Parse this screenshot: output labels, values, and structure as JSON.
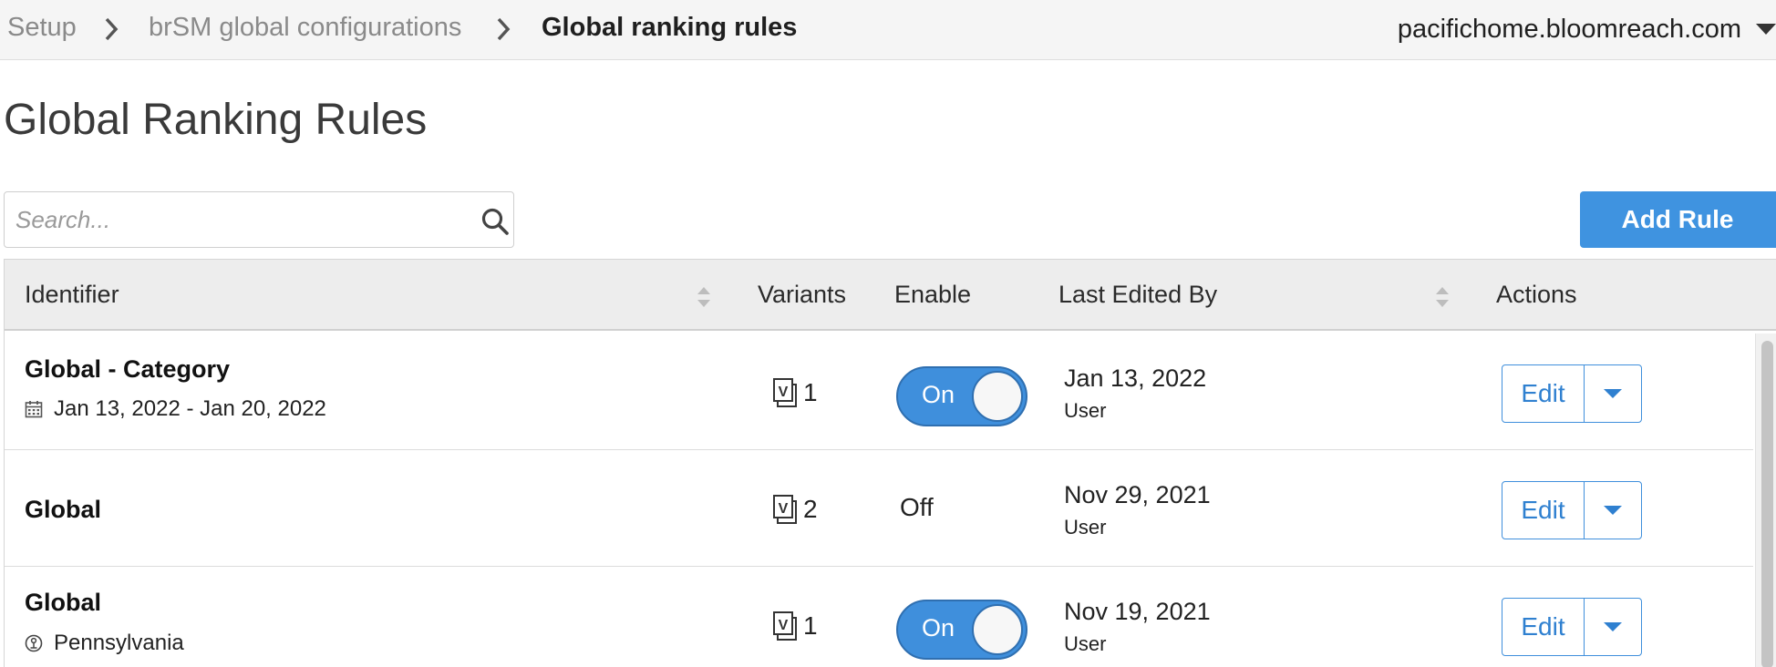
{
  "breadcrumb": {
    "items": [
      "Setup",
      "brSM global configurations",
      "Global ranking rules"
    ]
  },
  "domain_selector": {
    "value": "pacifichome.bloomreach.com"
  },
  "page_title": "Global Ranking Rules",
  "search": {
    "placeholder": "Search...",
    "value": ""
  },
  "add_rule_label": "Add Rule",
  "table": {
    "headers": {
      "identifier": "Identifier",
      "variants": "Variants",
      "enable": "Enable",
      "last_edited_by": "Last Edited By",
      "actions": "Actions"
    },
    "rows": [
      {
        "name": "Global - Category",
        "sub": "Jan 13, 2022 - Jan 20, 2022",
        "sub_icon": "calendar-icon",
        "variants": "1",
        "enabled": true,
        "toggle_label": "On",
        "edited_date": "Jan 13, 2022",
        "edited_user": "User",
        "edit_label": "Edit"
      },
      {
        "name": "Global",
        "sub": "",
        "sub_icon": "",
        "variants": "2",
        "enabled": false,
        "toggle_label": "Off",
        "edited_date": "Nov 29, 2021",
        "edited_user": "User",
        "edit_label": "Edit"
      },
      {
        "name": "Global",
        "sub": "Pennsylvania",
        "sub_icon": "location-icon",
        "variants": "1",
        "enabled": true,
        "toggle_label": "On",
        "edited_date": "Nov 19, 2021",
        "edited_user": "User",
        "edit_label": "Edit"
      }
    ]
  },
  "colors": {
    "accent": "#3f93e0",
    "toggle_on": "#3f8fdc",
    "header_bg": "#ededed",
    "topbar_bg": "#f5f5f5"
  }
}
